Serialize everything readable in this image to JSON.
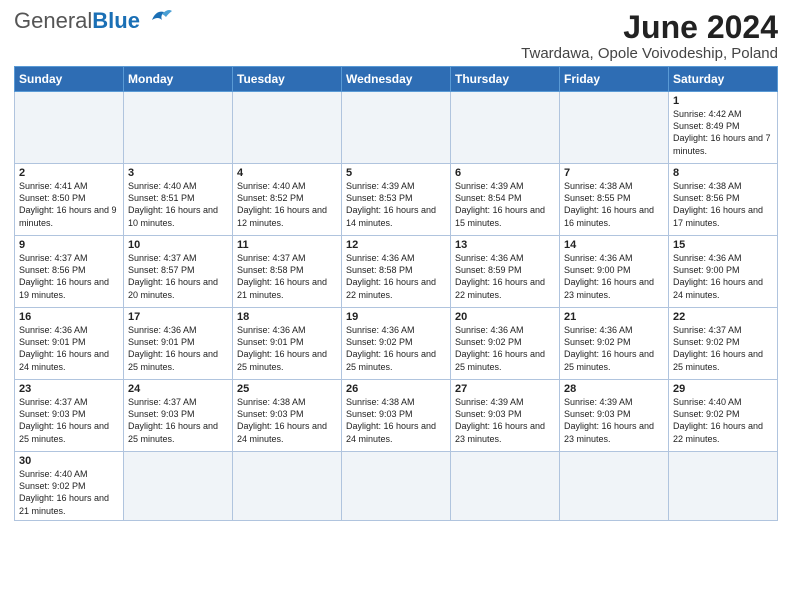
{
  "header": {
    "logo_general": "General",
    "logo_blue": "Blue",
    "title": "June 2024",
    "location": "Twardawa, Opole Voivodeship, Poland"
  },
  "days_of_week": [
    "Sunday",
    "Monday",
    "Tuesday",
    "Wednesday",
    "Thursday",
    "Friday",
    "Saturday"
  ],
  "weeks": [
    [
      {
        "day": "",
        "info": ""
      },
      {
        "day": "",
        "info": ""
      },
      {
        "day": "",
        "info": ""
      },
      {
        "day": "",
        "info": ""
      },
      {
        "day": "",
        "info": ""
      },
      {
        "day": "",
        "info": ""
      },
      {
        "day": "1",
        "info": "Sunrise: 4:42 AM\nSunset: 8:49 PM\nDaylight: 16 hours\nand 7 minutes."
      }
    ],
    [
      {
        "day": "2",
        "info": "Sunrise: 4:41 AM\nSunset: 8:50 PM\nDaylight: 16 hours\nand 9 minutes."
      },
      {
        "day": "3",
        "info": "Sunrise: 4:40 AM\nSunset: 8:51 PM\nDaylight: 16 hours\nand 10 minutes."
      },
      {
        "day": "4",
        "info": "Sunrise: 4:40 AM\nSunset: 8:52 PM\nDaylight: 16 hours\nand 12 minutes."
      },
      {
        "day": "5",
        "info": "Sunrise: 4:39 AM\nSunset: 8:53 PM\nDaylight: 16 hours\nand 14 minutes."
      },
      {
        "day": "6",
        "info": "Sunrise: 4:39 AM\nSunset: 8:54 PM\nDaylight: 16 hours\nand 15 minutes."
      },
      {
        "day": "7",
        "info": "Sunrise: 4:38 AM\nSunset: 8:55 PM\nDaylight: 16 hours\nand 16 minutes."
      },
      {
        "day": "8",
        "info": "Sunrise: 4:38 AM\nSunset: 8:56 PM\nDaylight: 16 hours\nand 17 minutes."
      }
    ],
    [
      {
        "day": "9",
        "info": "Sunrise: 4:37 AM\nSunset: 8:56 PM\nDaylight: 16 hours\nand 19 minutes."
      },
      {
        "day": "10",
        "info": "Sunrise: 4:37 AM\nSunset: 8:57 PM\nDaylight: 16 hours\nand 20 minutes."
      },
      {
        "day": "11",
        "info": "Sunrise: 4:37 AM\nSunset: 8:58 PM\nDaylight: 16 hours\nand 21 minutes."
      },
      {
        "day": "12",
        "info": "Sunrise: 4:36 AM\nSunset: 8:58 PM\nDaylight: 16 hours\nand 22 minutes."
      },
      {
        "day": "13",
        "info": "Sunrise: 4:36 AM\nSunset: 8:59 PM\nDaylight: 16 hours\nand 22 minutes."
      },
      {
        "day": "14",
        "info": "Sunrise: 4:36 AM\nSunset: 9:00 PM\nDaylight: 16 hours\nand 23 minutes."
      },
      {
        "day": "15",
        "info": "Sunrise: 4:36 AM\nSunset: 9:00 PM\nDaylight: 16 hours\nand 24 minutes."
      }
    ],
    [
      {
        "day": "16",
        "info": "Sunrise: 4:36 AM\nSunset: 9:01 PM\nDaylight: 16 hours\nand 24 minutes."
      },
      {
        "day": "17",
        "info": "Sunrise: 4:36 AM\nSunset: 9:01 PM\nDaylight: 16 hours\nand 25 minutes."
      },
      {
        "day": "18",
        "info": "Sunrise: 4:36 AM\nSunset: 9:01 PM\nDaylight: 16 hours\nand 25 minutes."
      },
      {
        "day": "19",
        "info": "Sunrise: 4:36 AM\nSunset: 9:02 PM\nDaylight: 16 hours\nand 25 minutes."
      },
      {
        "day": "20",
        "info": "Sunrise: 4:36 AM\nSunset: 9:02 PM\nDaylight: 16 hours\nand 25 minutes."
      },
      {
        "day": "21",
        "info": "Sunrise: 4:36 AM\nSunset: 9:02 PM\nDaylight: 16 hours\nand 25 minutes."
      },
      {
        "day": "22",
        "info": "Sunrise: 4:37 AM\nSunset: 9:02 PM\nDaylight: 16 hours\nand 25 minutes."
      }
    ],
    [
      {
        "day": "23",
        "info": "Sunrise: 4:37 AM\nSunset: 9:03 PM\nDaylight: 16 hours\nand 25 minutes."
      },
      {
        "day": "24",
        "info": "Sunrise: 4:37 AM\nSunset: 9:03 PM\nDaylight: 16 hours\nand 25 minutes."
      },
      {
        "day": "25",
        "info": "Sunrise: 4:38 AM\nSunset: 9:03 PM\nDaylight: 16 hours\nand 24 minutes."
      },
      {
        "day": "26",
        "info": "Sunrise: 4:38 AM\nSunset: 9:03 PM\nDaylight: 16 hours\nand 24 minutes."
      },
      {
        "day": "27",
        "info": "Sunrise: 4:39 AM\nSunset: 9:03 PM\nDaylight: 16 hours\nand 23 minutes."
      },
      {
        "day": "28",
        "info": "Sunrise: 4:39 AM\nSunset: 9:03 PM\nDaylight: 16 hours\nand 23 minutes."
      },
      {
        "day": "29",
        "info": "Sunrise: 4:40 AM\nSunset: 9:02 PM\nDaylight: 16 hours\nand 22 minutes."
      }
    ],
    [
      {
        "day": "30",
        "info": "Sunrise: 4:40 AM\nSunset: 9:02 PM\nDaylight: 16 hours\nand 21 minutes."
      },
      {
        "day": "",
        "info": ""
      },
      {
        "day": "",
        "info": ""
      },
      {
        "day": "",
        "info": ""
      },
      {
        "day": "",
        "info": ""
      },
      {
        "day": "",
        "info": ""
      },
      {
        "day": "",
        "info": ""
      }
    ]
  ]
}
